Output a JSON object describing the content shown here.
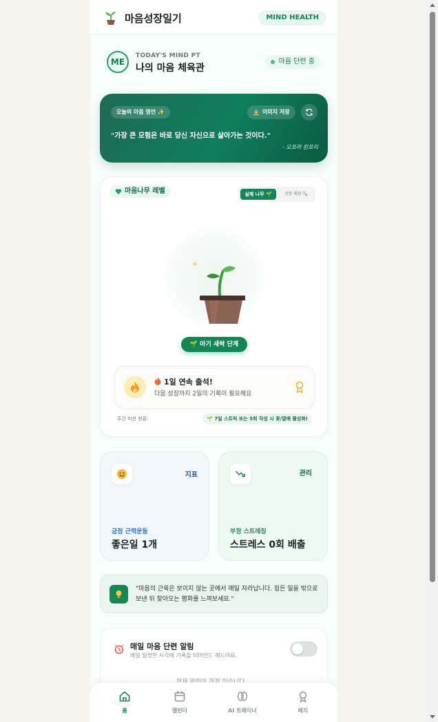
{
  "header": {
    "title": "마음성장일기",
    "badge": "MIND HEALTH"
  },
  "profile": {
    "avatar": "ME",
    "subtitle": "TODAY'S MIND PT",
    "name": "나의 마음 체육관",
    "status": "마음 단련 중"
  },
  "quote_card": {
    "tag": "오늘의 마음 명언 ✨",
    "save_label": "이미지 저장",
    "quote": "\"가장 큰 모험은 바로 당신 자신으로 살아가는 것이다.\"",
    "author": "- 오프라 윈프리",
    "icons": [
      "download-icon",
      "refresh-icon"
    ]
  },
  "tree_card": {
    "level_label": "마음나무 레벨",
    "tabs": {
      "real": "실제 나무 🌱",
      "experience": "성장 체험 🔍"
    },
    "stage_label": "🌱 아기 새싹 단계",
    "streak_title": "1일 연속 출석!",
    "streak_sub": "다음 성장까지 2일의 기록이 필요해요",
    "mission_label": "주간 미션 현황:",
    "mission_tag": "🌱 7일 스트릭 또는 5회 작성 시 꽃/열매 활성화!"
  },
  "stats": {
    "positive": {
      "tag": "지표",
      "label": "긍정 근력운동",
      "value": "좋은일 1개",
      "icon": "smile-icon"
    },
    "negative": {
      "tag": "관리",
      "label": "부정 스트레칭",
      "value": "스트레스 0회 배출",
      "icon": "trend-down-icon"
    }
  },
  "tip": {
    "text": "\"마음의 근육은 보이지 않는 곳에서 매일 자라납니다. 힘든 일을 밖으로 보낸 뒤 찾아오는 평화를 느껴보세요.\""
  },
  "alarm": {
    "title": "매일 마음 단련 알림",
    "subtitle": "매일 일정한 시각에 기록을 리마인드 해드려요.",
    "empty": "현재 알림이 꺼져 있습니다",
    "enabled": false
  },
  "nav": [
    {
      "label": "홈",
      "icon": "home-icon",
      "active": true
    },
    {
      "label": "캘린더",
      "icon": "calendar-icon",
      "active": false
    },
    {
      "label": "AI 트레이너",
      "icon": "brain-icon",
      "active": false
    },
    {
      "label": "배지",
      "icon": "medal-icon",
      "active": false
    }
  ],
  "colors": {
    "brand": "#128655",
    "quote_bg": "#0f7e5c",
    "positive": "#2f6fc4",
    "negative": "#1f8a5a"
  }
}
